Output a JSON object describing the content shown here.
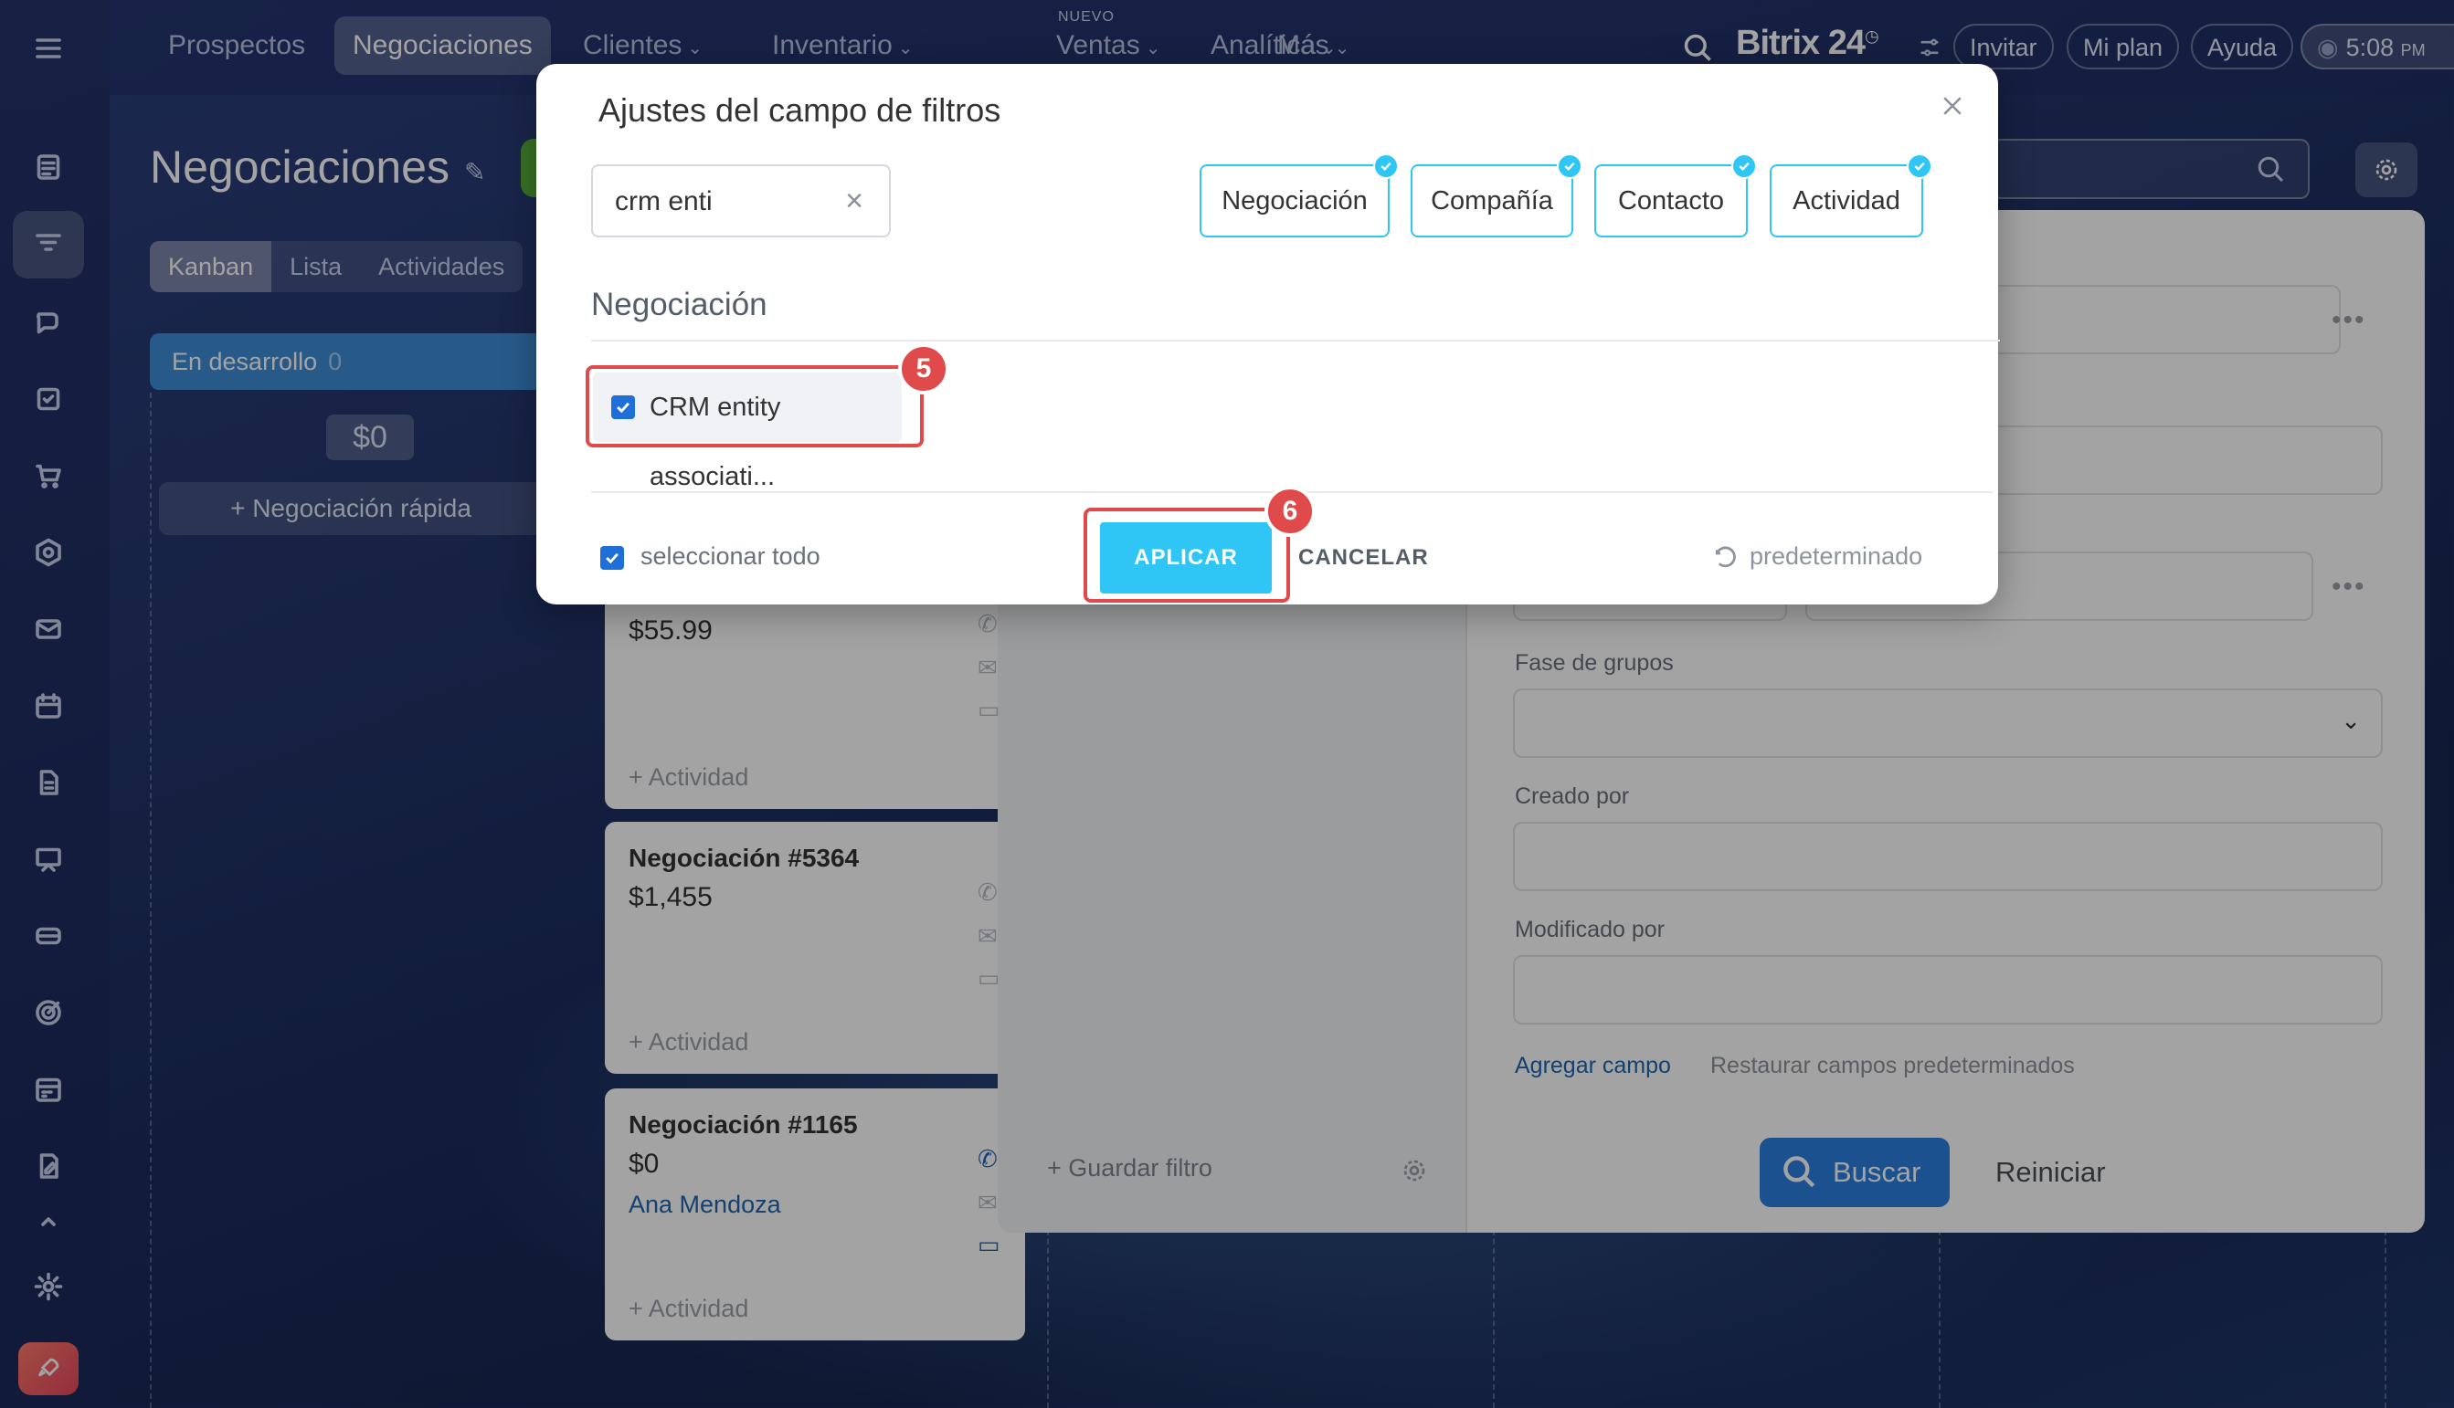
{
  "topnav": {
    "items": [
      "Prospectos",
      "Negociaciones",
      "Clientes",
      "Inventario",
      "Ventas",
      "Analítica",
      "Más"
    ],
    "ventas_badge": "NUEVO",
    "brand": "Bitrix",
    "brand_num": "24",
    "invite": "Invitar",
    "plan": "Mi plan",
    "help": "Ayuda",
    "time": "5:08",
    "ampm": "PM"
  },
  "page": {
    "title": "Negociaciones",
    "view_tabs": [
      "Kanban",
      "Lista",
      "Actividades"
    ],
    "stage": "En desarrollo",
    "stage_count": "0",
    "stage_sum": "$0",
    "quick_add": "Negociación rápida"
  },
  "cards": [
    {
      "title": "",
      "amount": "$55.99",
      "person": "",
      "activity": "+ Actividad"
    },
    {
      "title": "Negociación #5364",
      "amount": "$1,455",
      "person": "",
      "activity": "+ Actividad"
    },
    {
      "title": "Negociación #1165",
      "amount": "$0",
      "person": "Ana Mendoza",
      "activity": "+ Actividad"
    }
  ],
  "filter_panel": {
    "save_filter": "Guardar filtro",
    "fields": [
      {
        "label": "Fase de grupos"
      },
      {
        "label": "Creado por"
      },
      {
        "label": "Modificado por"
      }
    ],
    "add_field": "Agregar campo",
    "restore_fields": "Restaurar campos predeterminados",
    "search_button": "Buscar",
    "reset_button": "Reiniciar"
  },
  "modal": {
    "title": "Ajustes del campo de filtros",
    "search_value": "crm enti",
    "entity_tabs": [
      "Negociación",
      "Compañía",
      "Contacto",
      "Actividad"
    ],
    "section_title": "Negociación",
    "field_label": "CRM entity associati...",
    "select_all": "seleccionar todo",
    "apply": "APLICAR",
    "cancel": "CANCELAR",
    "default": "predeterminado",
    "step_badges": [
      "5",
      "6"
    ]
  },
  "colors": {
    "accent": "#2fc6f6",
    "highlight": "#e04a4a",
    "link": "#2067b0",
    "search_button": "#2b7fe0"
  }
}
